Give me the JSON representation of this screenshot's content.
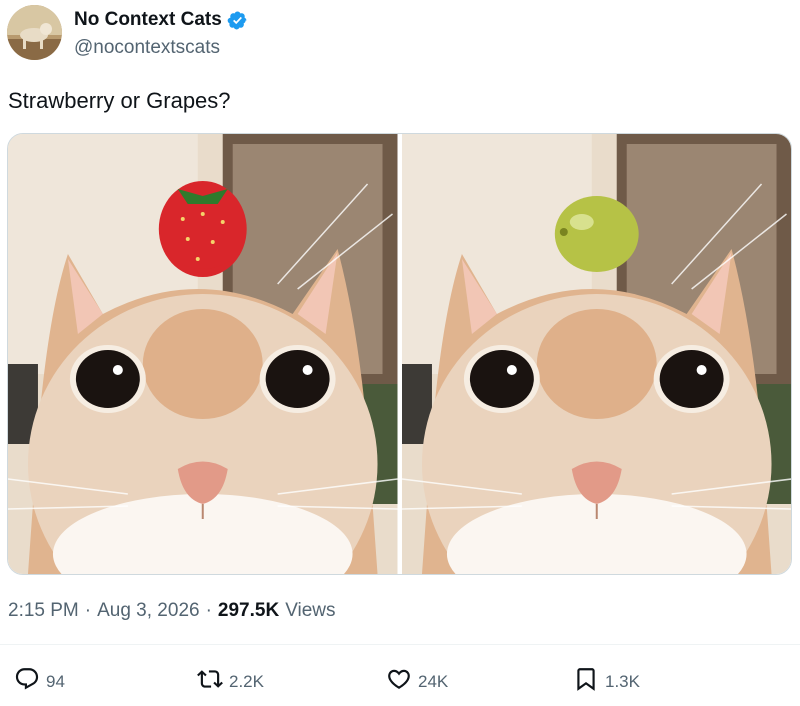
{
  "author": {
    "display_name": "No Context Cats",
    "handle": "@nocontextscats",
    "verified_icon": "verified-badge-icon",
    "badge_color": "#1d9bf0"
  },
  "tweet": {
    "text": "Strawberry or Grapes?"
  },
  "media": [
    {
      "subject": "cat with strawberry on head",
      "fruit_color": "#d9262b"
    },
    {
      "subject": "cat with grape on head",
      "fruit_color": "#b6c246"
    }
  ],
  "meta": {
    "time": "2:15 PM",
    "sep1": "·",
    "date": "Aug 3, 2026",
    "sep2": "·",
    "views_count": "297.5K",
    "views_label": "Views"
  },
  "actions": {
    "replies": "94",
    "retweets": "2.2K",
    "likes": "24K",
    "bookmarks": "1.3K"
  },
  "colors": {
    "text_primary": "#0f1419",
    "text_secondary": "#536471",
    "border": "#cfd9de"
  }
}
